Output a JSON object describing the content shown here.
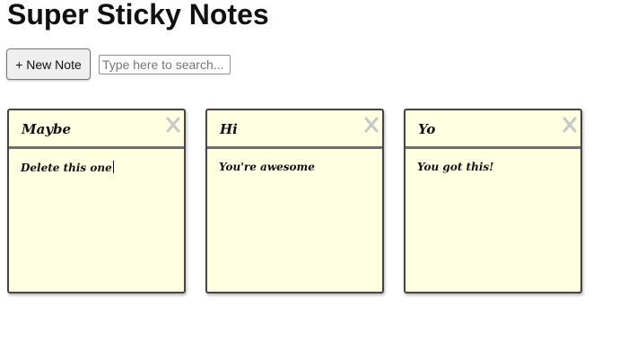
{
  "app": {
    "title": "Super Sticky Notes"
  },
  "toolbar": {
    "new_note_label": "+ New Note",
    "search_placeholder": "Type here to search...",
    "search_value": ""
  },
  "notes": [
    {
      "title": "Maybe",
      "body": "Delete this one",
      "focused": true
    },
    {
      "title": "Hi",
      "body": "You're awesome",
      "focused": false
    },
    {
      "title": "Yo",
      "body": "You got this!",
      "focused": false
    }
  ],
  "icons": {
    "delete": "close-x-icon"
  },
  "colors": {
    "note_background": "#ffffe2",
    "note_border": "#444444",
    "delete_icon": "#c8c8c8"
  }
}
